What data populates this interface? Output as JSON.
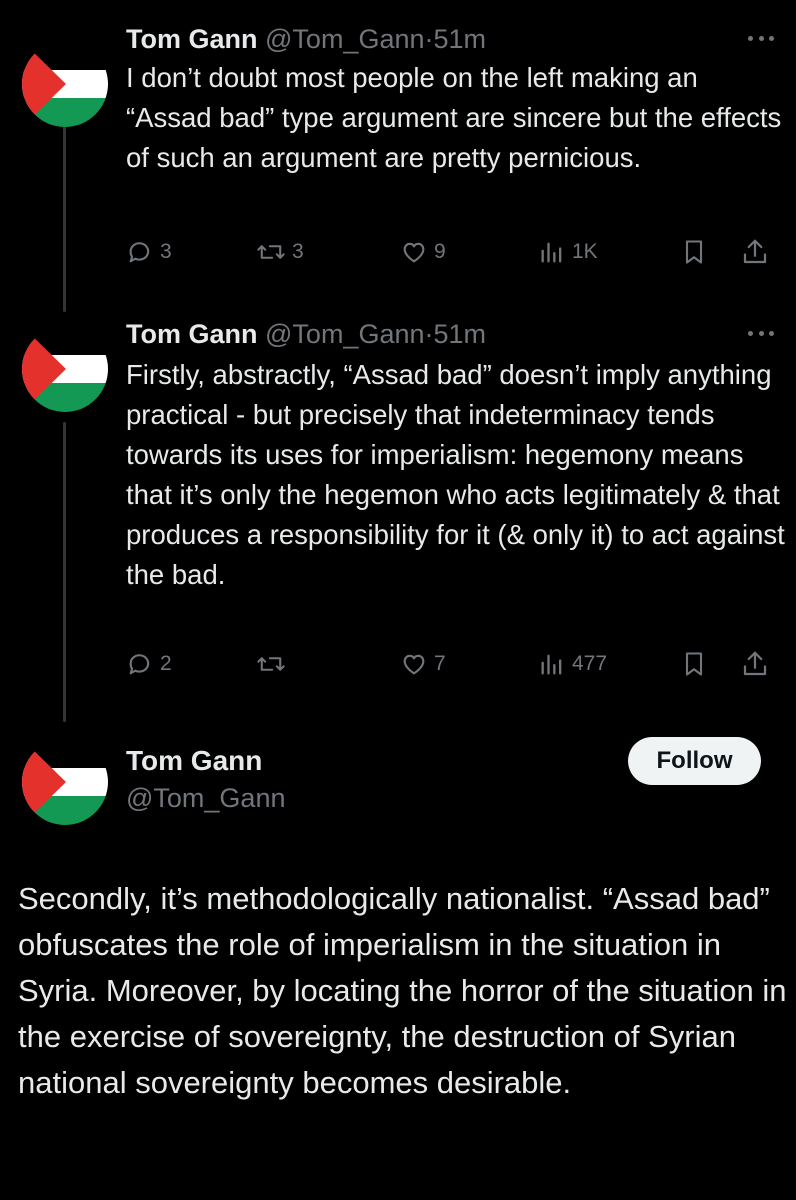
{
  "tweets": [
    {
      "name": "Tom Gann",
      "handle": "@Tom_Gann",
      "sep": "·",
      "time": "51m",
      "text": "I don’t doubt most people on the left making an “Assad bad” type argument are sincere but the effects of such an argument are pretty pernicious.",
      "replies": "3",
      "reposts": "3",
      "likes": "9",
      "views": "1K"
    },
    {
      "name": "Tom Gann",
      "handle": "@Tom_Gann",
      "sep": "·",
      "time": "51m",
      "text": "Firstly, abstractly, “Assad bad” doesn’t imply anything practical - but precisely that indeterminacy tends towards its uses for imperialism: hegemony means that it’s only the hegemon who acts legitimately & that produces a responsibility for it (& only it) to act against the bad.",
      "replies": "2",
      "reposts": "",
      "likes": "7",
      "views": "477"
    }
  ],
  "main_tweet": {
    "name": "Tom Gann",
    "handle": "@Tom_Gann",
    "follow_label": "Follow",
    "text": "Secondly, it’s methodologically nationalist. “Assad bad” obfuscates the role of imperialism in the situation  in Syria. Moreover, by locating the horror of the situation in the exercise of sovereignty, the destruction of Syrian national sovereignty becomes desirable."
  },
  "icons": [
    "palestine-flag-avatar",
    "more-icon",
    "reply-icon",
    "repost-icon",
    "like-icon",
    "views-icon",
    "bookmark-icon",
    "share-icon"
  ],
  "colors": {
    "background": "#000000",
    "text": "#e7e9ea",
    "muted": "#71767b",
    "follow_bg": "#eff3f4"
  }
}
